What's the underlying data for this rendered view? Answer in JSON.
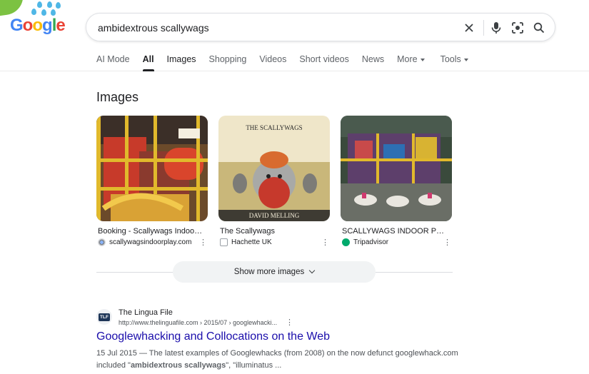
{
  "logo": {
    "letters": [
      "G",
      "o",
      "o",
      "g",
      "l",
      "e"
    ]
  },
  "search": {
    "query": "ambidextrous scallywags"
  },
  "tabs": [
    {
      "label": "AI Mode",
      "active": false
    },
    {
      "label": "All",
      "active": true
    },
    {
      "label": "Images",
      "active": false
    },
    {
      "label": "Shopping",
      "active": false
    },
    {
      "label": "Videos",
      "active": false
    },
    {
      "label": "Short videos",
      "active": false
    },
    {
      "label": "News",
      "active": false
    },
    {
      "label": "More",
      "active": false,
      "dropdown": true
    },
    {
      "label": "Tools",
      "active": false,
      "dropdown": true
    }
  ],
  "images_section": {
    "heading": "Images",
    "cards": [
      {
        "title": "Booking - Scallywags Indoor ...",
        "source": "scallywagsindoorplay.com",
        "icon": "globe-favicon"
      },
      {
        "title": "The Scallywags",
        "source": "Hachette UK",
        "icon": "hachette-favicon",
        "cover_title": "THE SCALLYWAGS",
        "cover_author": "DAVID MELLING"
      },
      {
        "title": "SCALLYWAGS INDOOR PLAY ...",
        "source": "Tripadvisor",
        "icon": "tripadvisor-favicon"
      }
    ],
    "show_more": "Show more images"
  },
  "result": {
    "favicon_text": "TLF",
    "site_name": "The Lingua File",
    "url": "http://www.thelinguafile.com › 2015/07 › googlewhacki...",
    "title": "Googlewhacking and Collocations on the Web",
    "date": "15 Jul 2015",
    "snippet_a": " — The latest examples of Googlewhacks (from 2008) on the now defunct googlewhack.com included \"",
    "snippet_bold": "ambidextrous scallywags",
    "snippet_b": "\", \"illuminatus ..."
  },
  "colors": {
    "link": "#1a0dab",
    "accent": "#1a73e8",
    "text": "#202124",
    "muted": "#5f6368"
  }
}
